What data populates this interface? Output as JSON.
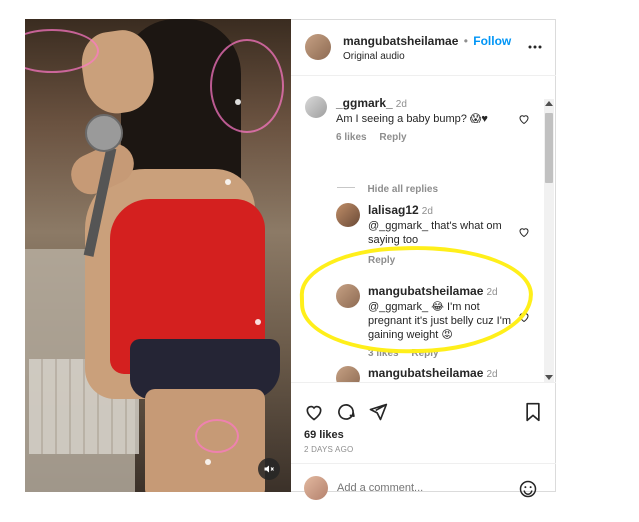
{
  "post": {
    "username": "mangubatsheilamae",
    "follow_label": "Follow",
    "separator": "•",
    "audio": "Original audio",
    "more_icon": "more-horizontal-icon"
  },
  "comments": [
    {
      "username": "_ggmark_",
      "time": "2d",
      "text": "Am I seeing a baby bump? 😱♥",
      "likes": "6 likes",
      "reply_label": "Reply",
      "hide_replies": "Hide all replies"
    },
    {
      "username": "lalisag12",
      "time": "2d",
      "text": "@_ggmark_ that's what om saying too",
      "reply_label": "Reply"
    },
    {
      "username": "mangubatsheilamae",
      "time": "2d",
      "text": "@_ggmark_ 😂 I'm not pregnant it's just belly cuz I'm gaining weight 😡",
      "likes": "3 likes",
      "reply_label": "Reply"
    },
    {
      "username": "mangubatsheilamae",
      "time": "2d"
    }
  ],
  "stats": {
    "likes": "69 likes",
    "date": "2 DAYS AGO"
  },
  "composer": {
    "placeholder": "Add a comment..."
  },
  "icons": {
    "like": "heart-icon",
    "comment": "comment-icon",
    "share": "share-icon",
    "save": "bookmark-icon",
    "mute": "muted-speaker-icon",
    "emoji": "emoji-icon"
  },
  "colors": {
    "link": "#0095f6",
    "highlight": "#ffef1a",
    "text": "#262626",
    "muted": "#8e8e8e"
  }
}
